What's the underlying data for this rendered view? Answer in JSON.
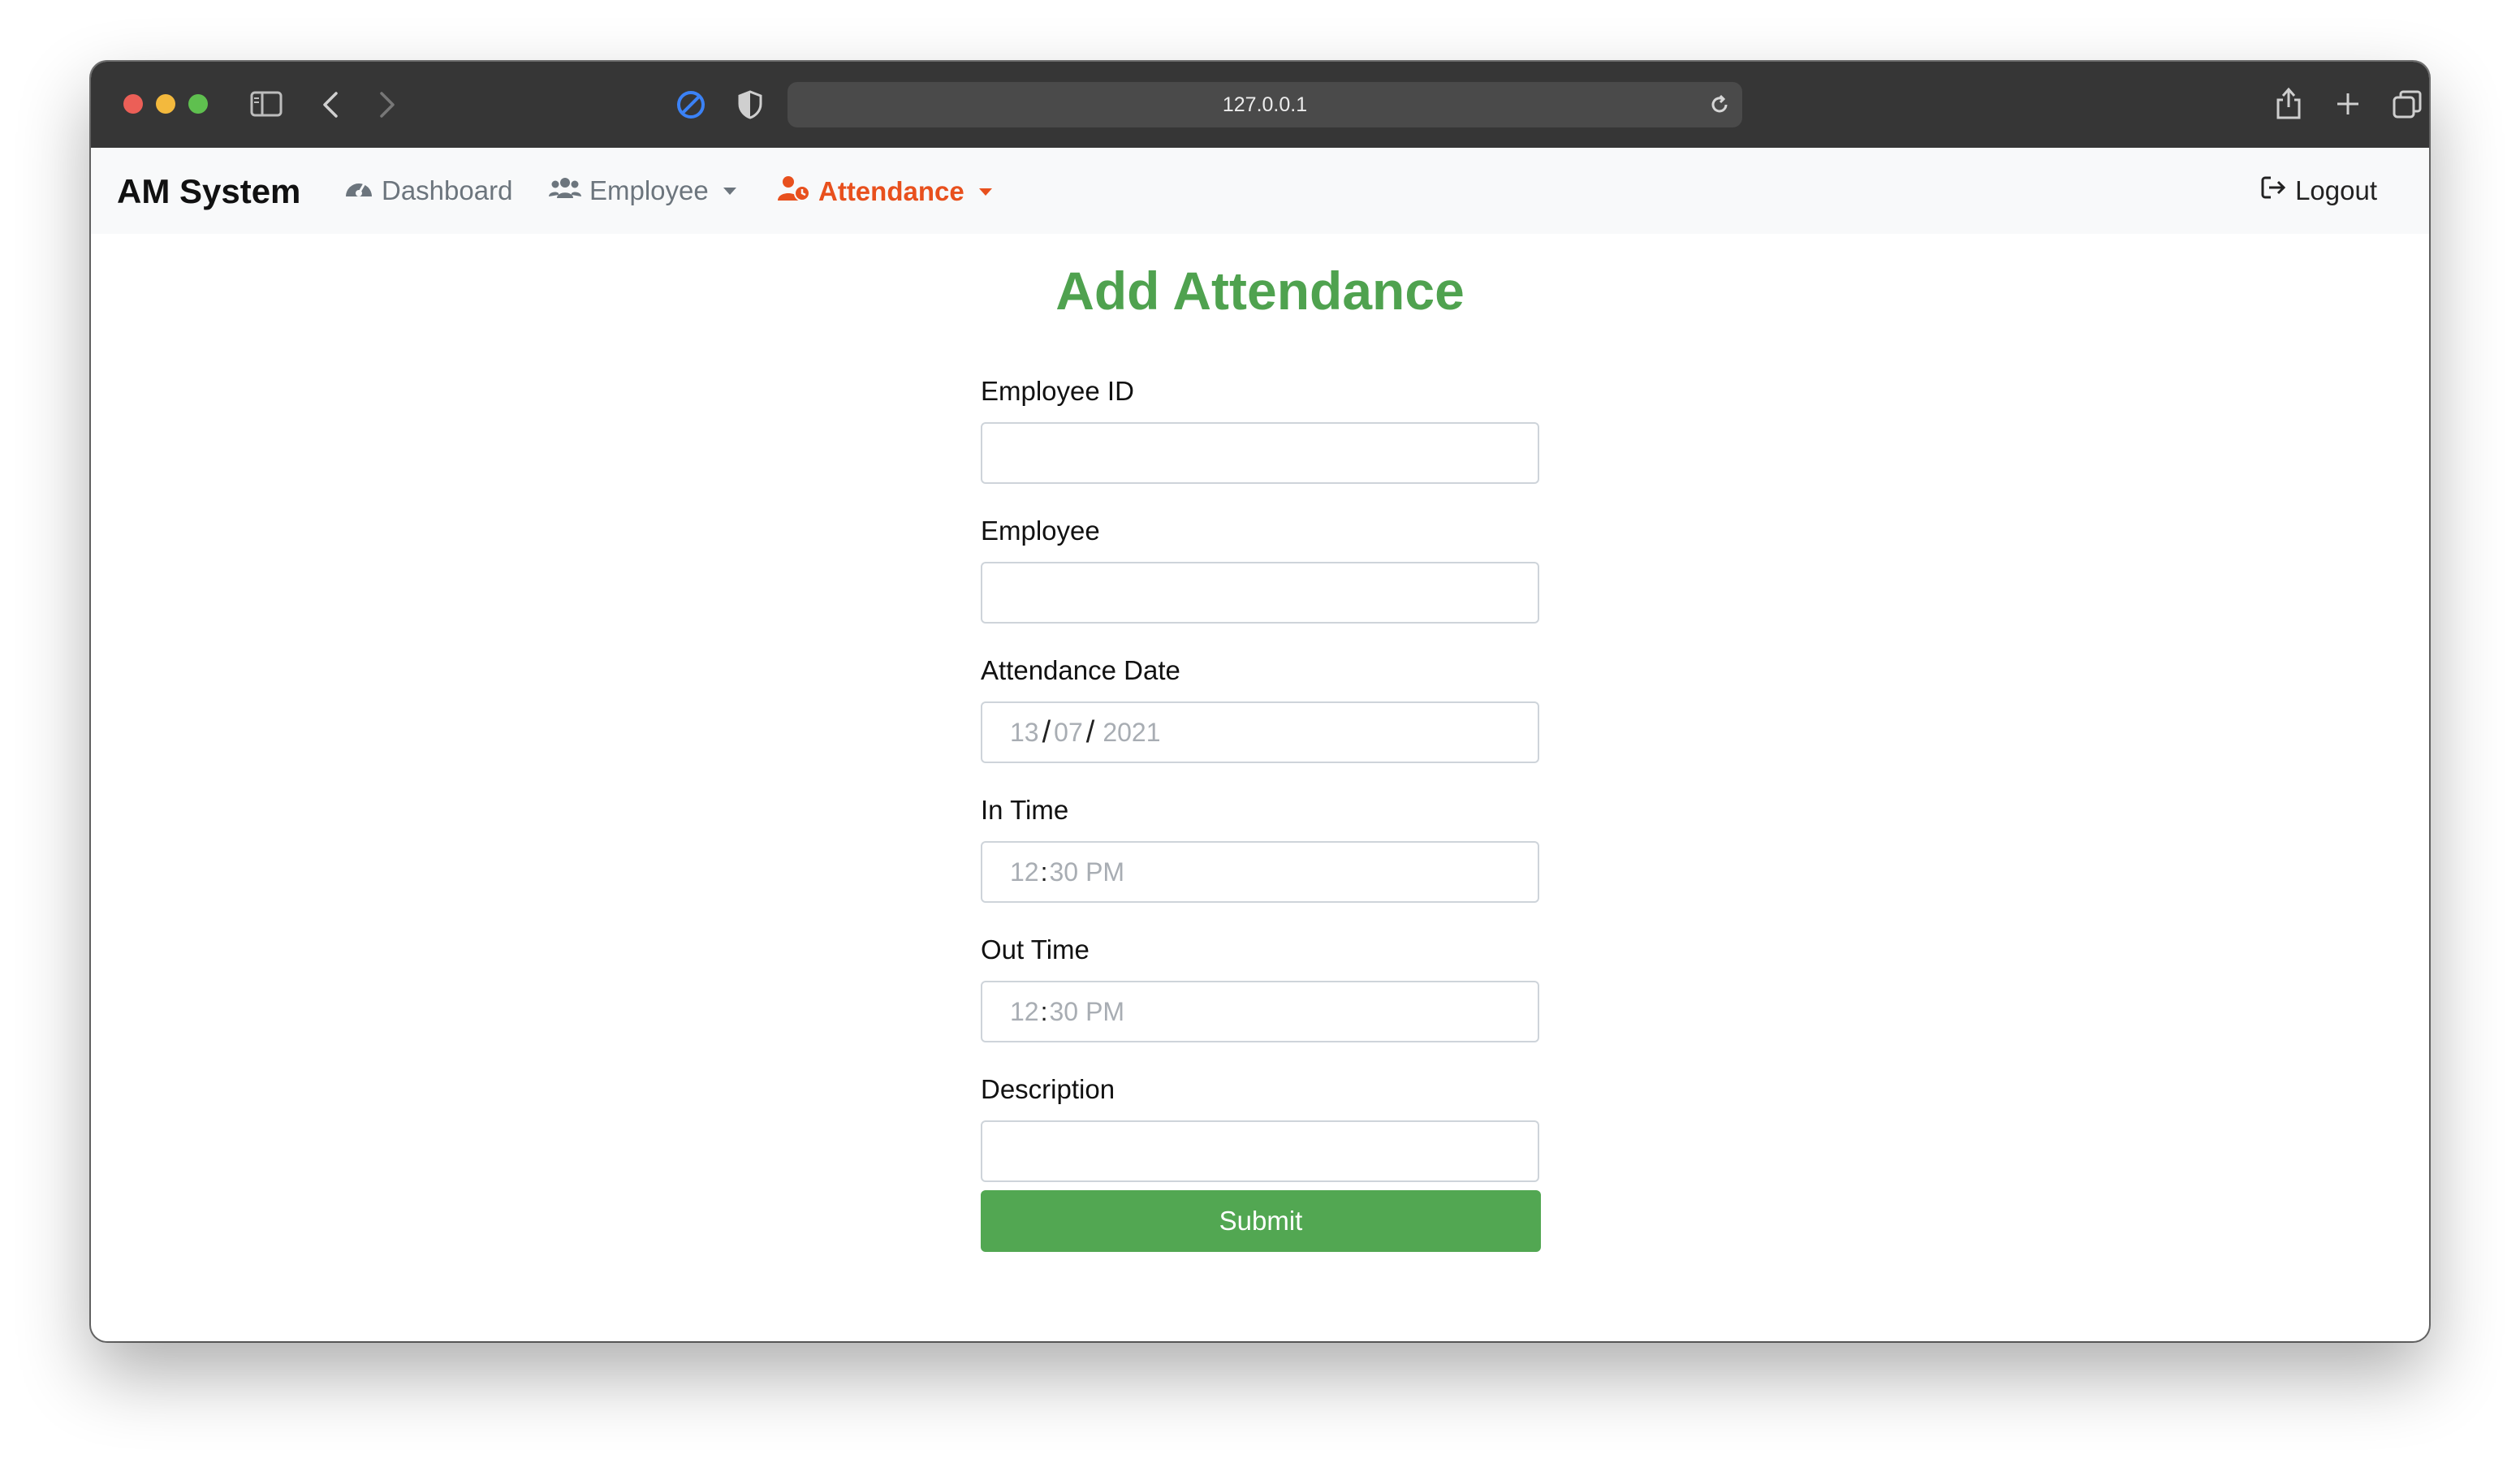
{
  "browser": {
    "url": "127.0.0.1"
  },
  "navbar": {
    "brand": "AM System",
    "items": [
      {
        "label": "Dashboard",
        "icon": "dashboard-gauge-icon",
        "dropdown": false
      },
      {
        "label": "Employee",
        "icon": "users-icon",
        "dropdown": true
      },
      {
        "label": "Attendance",
        "icon": "user-clock-icon",
        "dropdown": true,
        "active": true
      }
    ],
    "logout": "Logout"
  },
  "page": {
    "title": "Add Attendance"
  },
  "form": {
    "employee_id": {
      "label": "Employee ID",
      "value": ""
    },
    "employee": {
      "label": "Employee",
      "value": ""
    },
    "attendance_date": {
      "label": "Attendance Date",
      "day": "13",
      "month": "07",
      "year": "2021"
    },
    "in_time": {
      "label": "In Time",
      "hour": "12",
      "minute": "30",
      "ampm": "PM"
    },
    "out_time": {
      "label": "Out Time",
      "hour": "12",
      "minute": "30",
      "ampm": "PM"
    },
    "description": {
      "label": "Description",
      "value": ""
    },
    "submit_label": "Submit"
  },
  "colors": {
    "accent_green": "#4fa24f",
    "active_nav": "#e8501d",
    "titlebar": "#363636"
  }
}
